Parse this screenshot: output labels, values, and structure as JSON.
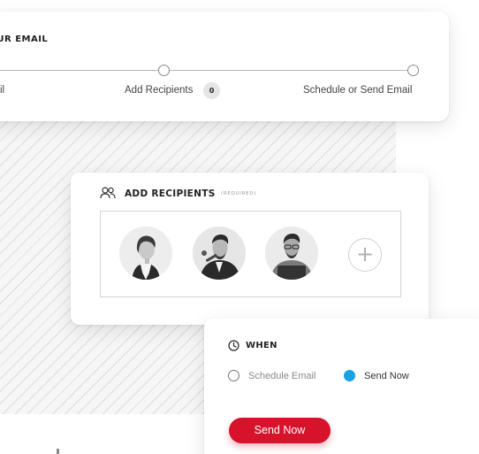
{
  "stepper": {
    "title": "YOUR EMAIL",
    "steps": [
      {
        "label": "il"
      },
      {
        "label": "Add Recipients",
        "badge": "0"
      },
      {
        "label": "Schedule or Send Email"
      }
    ]
  },
  "recipients": {
    "title": "ADD RECIPIENTS",
    "required": "(REQUIRED)",
    "icon": "users-icon",
    "add_icon": "plus-icon"
  },
  "when": {
    "title": "WHEN",
    "icon": "clock-icon",
    "options": [
      {
        "label": "Schedule Email",
        "selected": false
      },
      {
        "label": "Send Now",
        "selected": true
      }
    ],
    "button": "Send Now"
  },
  "colors": {
    "accent": "#d6132a",
    "radio_selected": "#1aa3e0"
  }
}
